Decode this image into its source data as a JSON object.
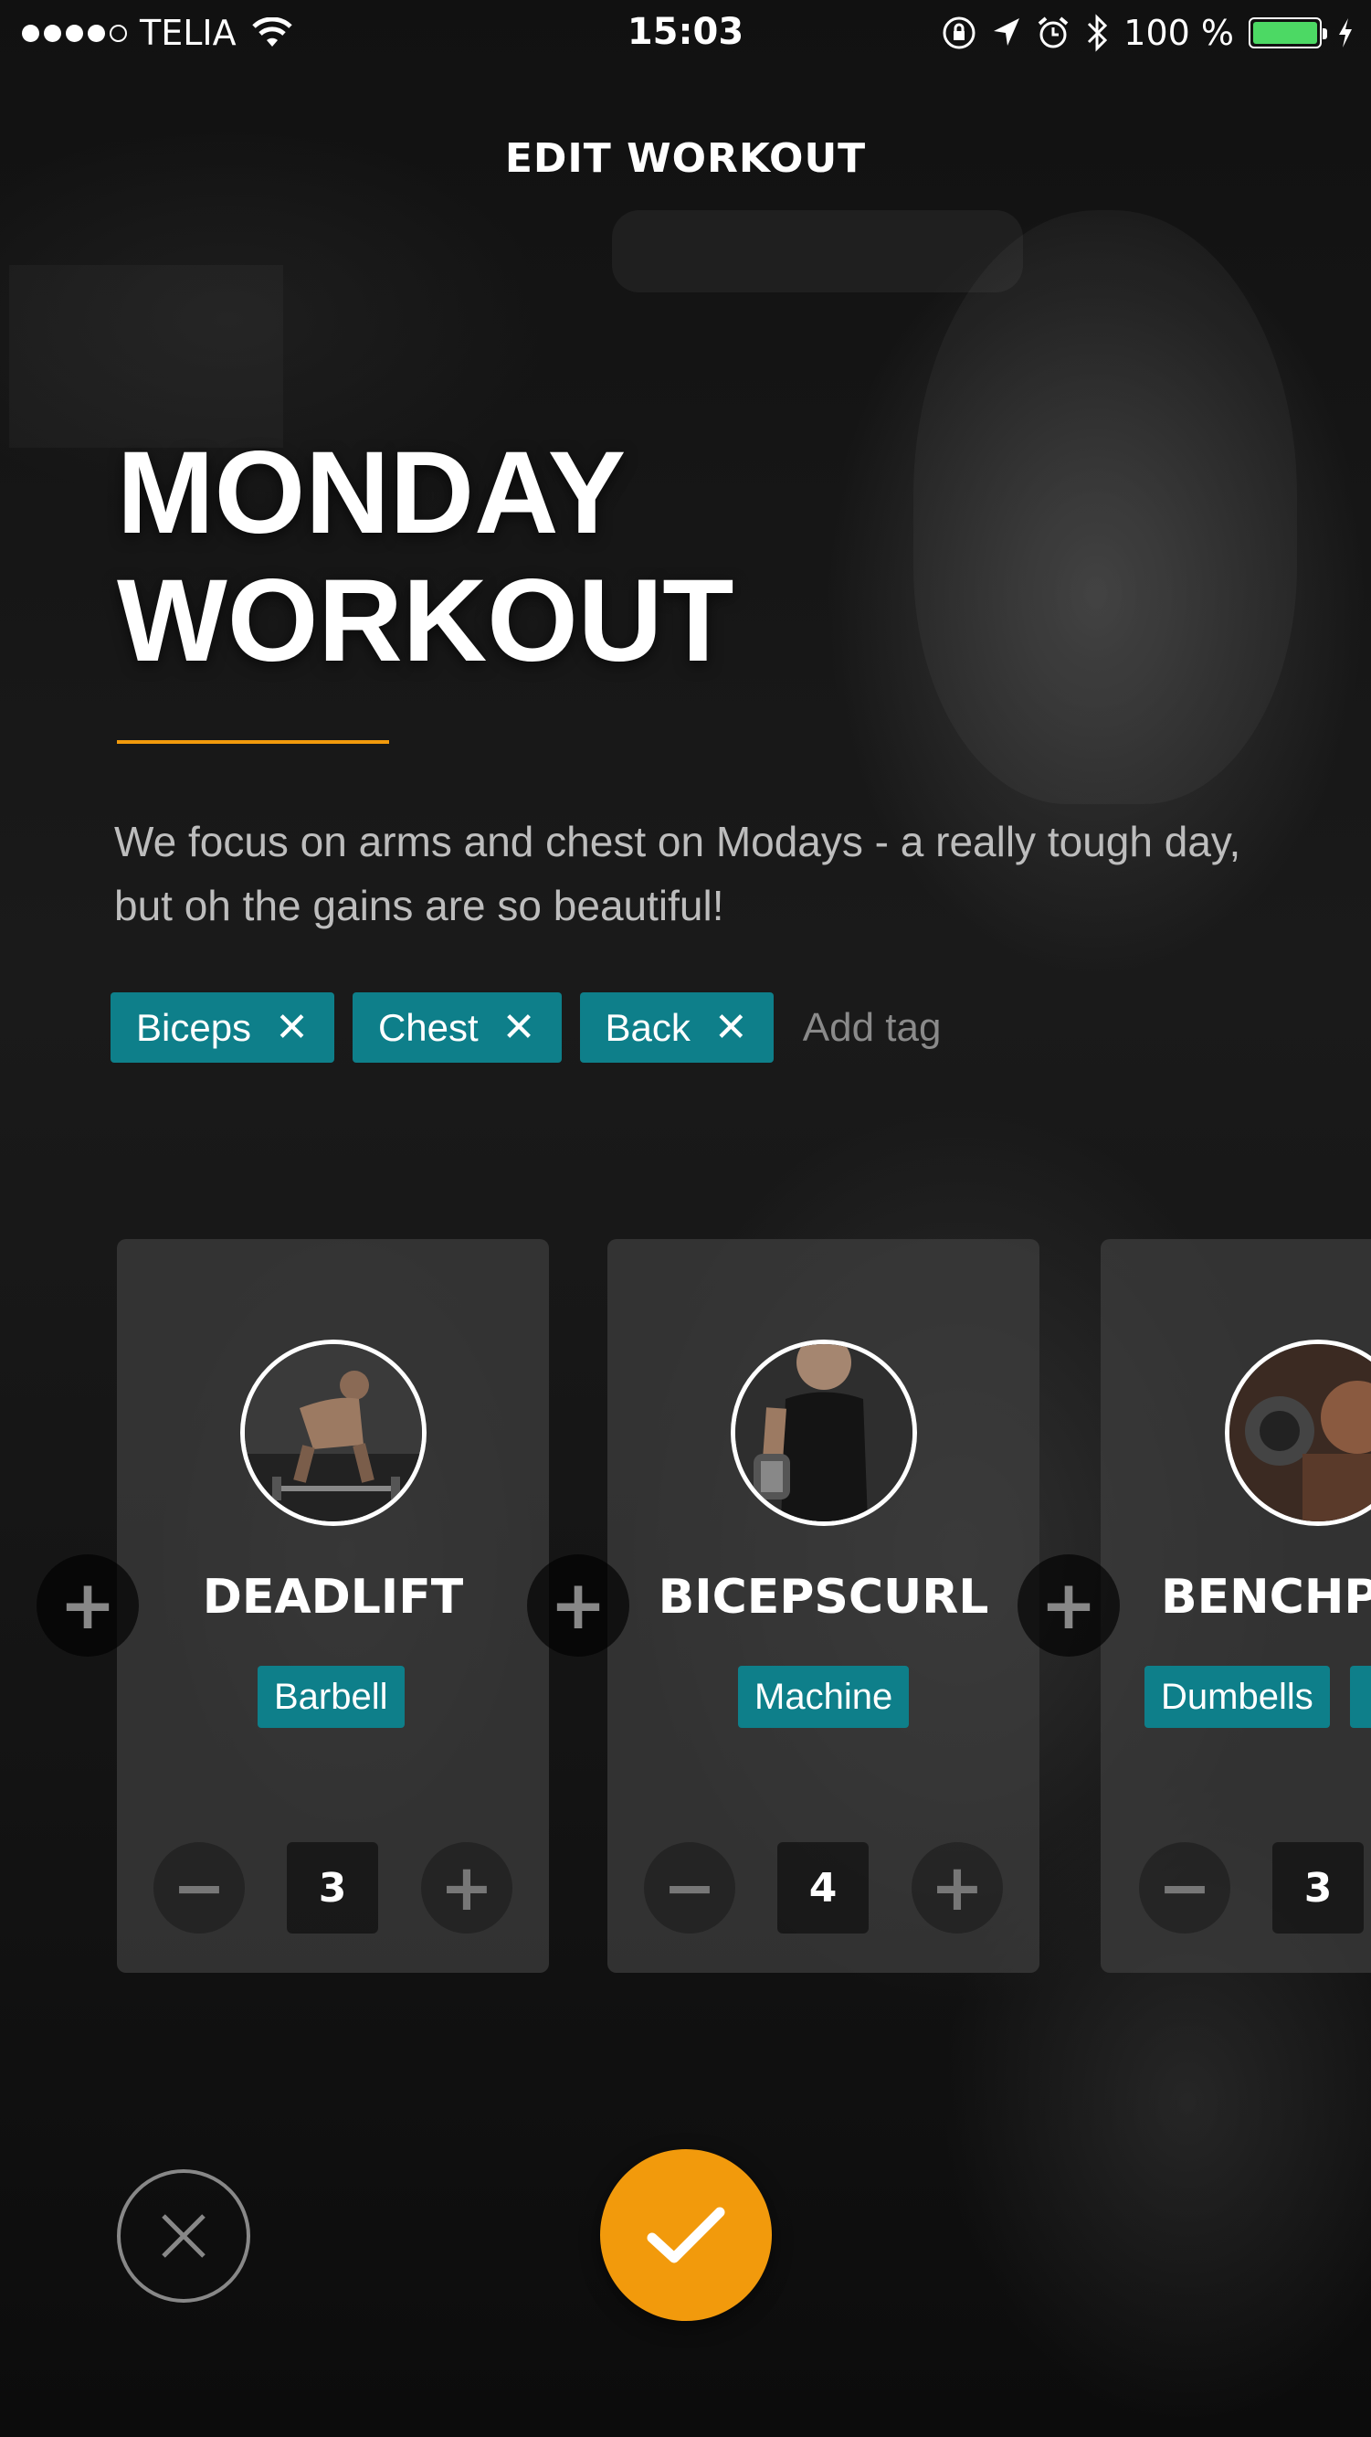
{
  "status_bar": {
    "carrier": "TELIA",
    "time": "15:03",
    "battery_percent": "100 %",
    "battery_level": 1.0,
    "signal_bars": 4,
    "icons": [
      "wifi-icon",
      "rotation-lock-icon",
      "location-icon",
      "alarm-icon",
      "bluetooth-icon",
      "battery-icon",
      "charging-icon"
    ]
  },
  "header": {
    "title": "EDIT WORKOUT"
  },
  "workout": {
    "title_line1": "MONDAY",
    "title_line2": "WORKOUT",
    "description": "We focus on arms and chest on Modays - a really tough day, but oh the gains are so beautiful!",
    "tags": [
      {
        "label": "Biceps",
        "remove_icon": "close-icon"
      },
      {
        "label": "Chest",
        "remove_icon": "close-icon"
      },
      {
        "label": "Back",
        "remove_icon": "close-icon"
      }
    ],
    "add_tag_placeholder": "Add tag"
  },
  "exercises": [
    {
      "name": "DEADLIFT",
      "equipment": [
        "Barbell"
      ],
      "count": "3"
    },
    {
      "name": "BICEPSCURL",
      "equipment": [
        "Machine"
      ],
      "count": "4"
    },
    {
      "name": "BENCHPRESS",
      "equipment": [
        "Dumbells"
      ],
      "count": "3"
    }
  ],
  "actions": {
    "cancel_icon": "close-icon",
    "confirm_icon": "checkmark-icon",
    "accent_color": "#f29a0c",
    "tag_color": "#0e7f8a"
  }
}
